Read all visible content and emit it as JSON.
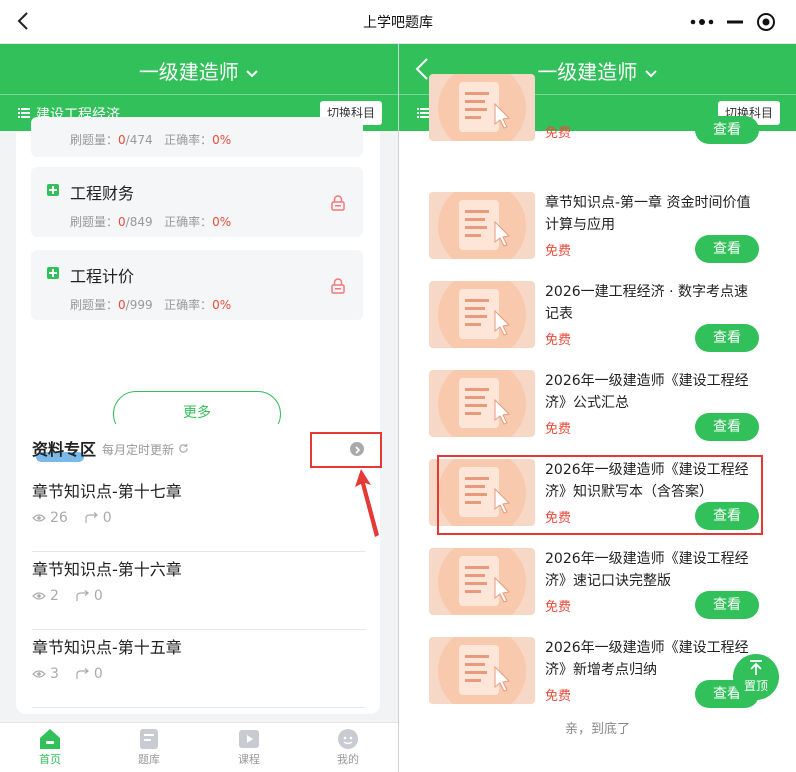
{
  "app": {
    "title": "上学吧题库"
  },
  "header": {
    "exam": "一级建造师",
    "subject": "建设工程经济",
    "switch_label": "切换科目"
  },
  "left": {
    "items": [
      {
        "name": "",
        "stats_label_1": "刷题量：",
        "done": "0",
        "total": "/474",
        "stats_label_2": "正确率：",
        "rate": "0%"
      },
      {
        "name": "工程财务",
        "stats_label_1": "刷题量：",
        "done": "0",
        "total": "/849",
        "stats_label_2": "正确率：",
        "rate": "0%"
      },
      {
        "name": "工程计价",
        "stats_label_1": "刷题量：",
        "done": "0",
        "total": "/999",
        "stats_label_2": "正确率：",
        "rate": "0%"
      }
    ],
    "more_label": "更多",
    "materials": {
      "title": "资料专区",
      "update_note": "每月定时更新",
      "chapters": [
        {
          "title": "章节知识点-第十七章",
          "views": "26",
          "shares": "0"
        },
        {
          "title": "章节知识点-第十六章",
          "views": "2",
          "shares": "0"
        },
        {
          "title": "章节知识点-第十五章",
          "views": "3",
          "shares": "0"
        }
      ]
    },
    "tabs": [
      {
        "label": "首页",
        "icon": "home-icon"
      },
      {
        "label": "题库",
        "icon": "question-bank-icon"
      },
      {
        "label": "课程",
        "icon": "video-course-icon"
      },
      {
        "label": "我的",
        "icon": "profile-icon"
      }
    ]
  },
  "right": {
    "resources": [
      {
        "title": "",
        "free": "免费",
        "view": "查看"
      },
      {
        "title": "章节知识点-第一章 资金时间价值计算与应用",
        "free": "免费",
        "view": "查看"
      },
      {
        "title": "2026一建工程经济 · 数字考点速记表",
        "free": "免费",
        "view": "查看"
      },
      {
        "title": "2026年一级建造师《建设工程经济》公式汇总",
        "free": "免费",
        "view": "查看"
      },
      {
        "title": "2026年一级建造师《建设工程经济》知识默写本（含答案）",
        "free": "免费",
        "view": "查看"
      },
      {
        "title": "2026年一级建造师《建设工程经济》速记口诀完整版",
        "free": "免费",
        "view": "查看"
      },
      {
        "title": "2026年一级建造师《建设工程经济》新增考点归纳",
        "free": "免费",
        "view": "查看"
      }
    ],
    "bottom_text": "亲，到底了",
    "to_top_label": "置顶"
  },
  "colors": {
    "brand_green": "#32c05a",
    "accent_red": "#e74c3c",
    "highlight_box": "#e53935"
  }
}
